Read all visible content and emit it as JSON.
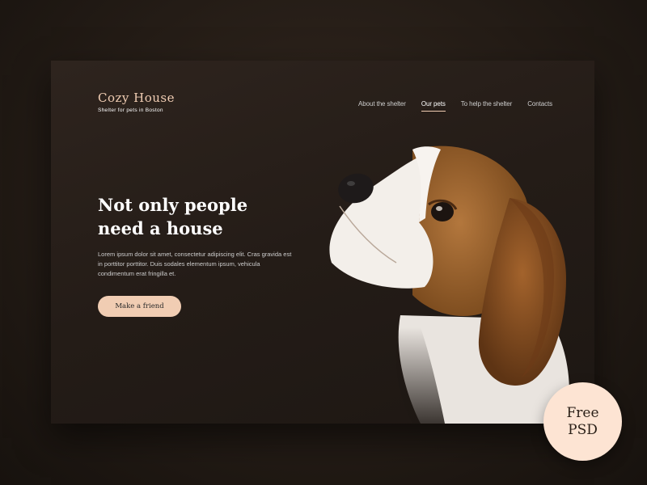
{
  "header": {
    "logo_title": "Cozy House",
    "logo_subtitle": "Shelter for pets in Boston"
  },
  "nav": {
    "items": [
      "About the shelter",
      "Our pets",
      "To help the shelter",
      "Contacts"
    ],
    "active": "Our pets"
  },
  "hero": {
    "title": "Not only people\nneed a house",
    "text": "Lorem ipsum dolor sit amet, consectetur adipiscing elit. Cras gravida est in porttitor  porttitor. Duis sodales elementum ipsum, vehicula condimentum erat fringilla et.",
    "cta_label": "Make a friend"
  },
  "badge": {
    "line1": "Free",
    "line2": "PSD"
  },
  "image": {
    "subject": "beagle-puppy-photo"
  },
  "colors": {
    "accent": "#f1cdb3",
    "badge": "#fde4d3",
    "background": "#2a211b"
  }
}
